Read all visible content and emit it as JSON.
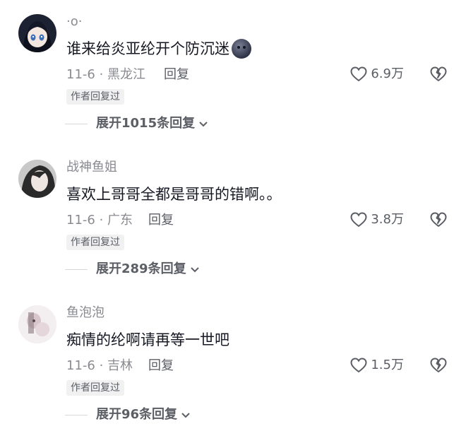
{
  "comments": [
    {
      "username": "·o·",
      "text": "谁来给炎亚纶开个防沉迷",
      "date_location": "11-6 · 黑龙江",
      "reply_label": "回复",
      "likes": "6.9万",
      "author_tag": "作者回复过",
      "expand_label": "展开1015条回复",
      "emoji": "dark-ball-emoji"
    },
    {
      "username": "战神鱼姐",
      "text": "喜欢上哥哥全都是哥哥的错啊。。",
      "date_location": "11-6 · 广东",
      "reply_label": "回复",
      "likes": "3.8万",
      "author_tag": "作者回复过",
      "expand_label": "展开289条回复"
    },
    {
      "username": "鱼泡泡",
      "text": "痴情的纶啊请再等一世吧",
      "date_location": "11-6 · 吉林",
      "reply_label": "回复",
      "likes": "1.5万",
      "author_tag": "作者回复过",
      "expand_label": "展开96条回复"
    }
  ],
  "colors": {
    "primary_text": "#161823",
    "secondary_text": "#8a8b91",
    "action_text": "#5c5e66",
    "tag_bg": "#f1f1f2"
  }
}
